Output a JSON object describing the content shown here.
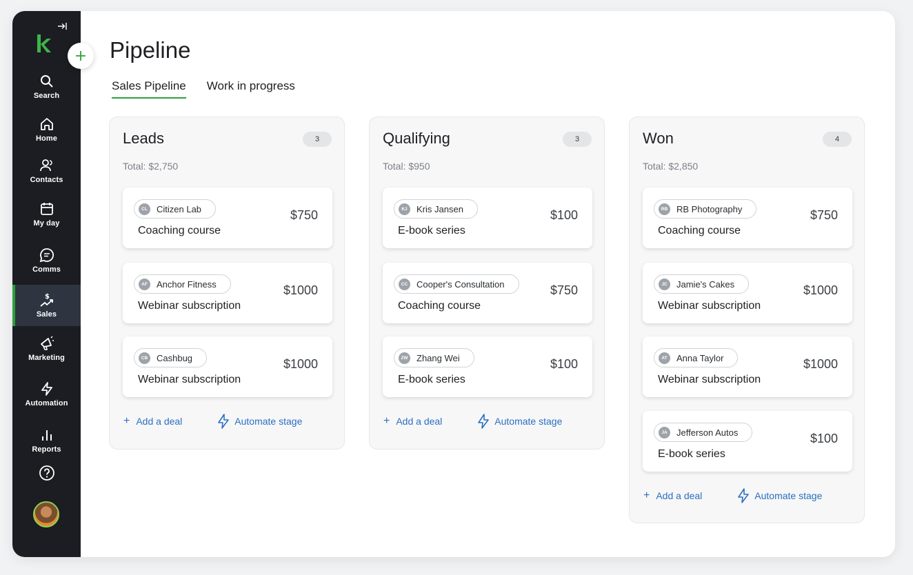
{
  "app": {
    "brand_color": "#2e9e3e",
    "link_color": "#2a6fc0"
  },
  "sidebar": {
    "items": [
      {
        "label": "Search",
        "icon": "search-icon"
      },
      {
        "label": "Home",
        "icon": "home-icon"
      },
      {
        "label": "Contacts",
        "icon": "contacts-icon"
      },
      {
        "label": "My day",
        "icon": "calendar-icon"
      },
      {
        "label": "Comms",
        "icon": "chat-icon"
      },
      {
        "label": "Sales",
        "icon": "sales-icon",
        "active": true
      },
      {
        "label": "Marketing",
        "icon": "megaphone-icon"
      },
      {
        "label": "Automation",
        "icon": "lightning-icon"
      },
      {
        "label": "Reports",
        "icon": "bar-chart-icon"
      }
    ]
  },
  "header": {
    "title": "Pipeline",
    "tabs": [
      {
        "label": "Sales Pipeline",
        "active": true
      },
      {
        "label": "Work in progress",
        "active": false
      }
    ]
  },
  "actions": {
    "add_deal": "Add a deal",
    "automate_stage": "Automate stage"
  },
  "columns": [
    {
      "title": "Leads",
      "count": "3",
      "total": "Total: $2,750",
      "deals": [
        {
          "initials": "CL",
          "contact": "Citizen Lab",
          "title": "Coaching course",
          "amount": "$750"
        },
        {
          "initials": "AF",
          "contact": "Anchor Fitness",
          "title": "Webinar subscription",
          "amount": "$1000"
        },
        {
          "initials": "CB",
          "contact": "Cashbug",
          "title": "Webinar subscription",
          "amount": "$1000"
        }
      ]
    },
    {
      "title": "Qualifying",
      "count": "3",
      "total": "Total: $950",
      "deals": [
        {
          "initials": "KJ",
          "contact": "Kris Jansen",
          "title": "E-book series",
          "amount": "$100"
        },
        {
          "initials": "CC",
          "contact": "Cooper's Consultation",
          "title": "Coaching course",
          "amount": "$750"
        },
        {
          "initials": "ZW",
          "contact": "Zhang Wei",
          "title": "E-book series",
          "amount": "$100"
        }
      ]
    },
    {
      "title": "Won",
      "count": "4",
      "total": "Total: $2,850",
      "deals": [
        {
          "initials": "RB",
          "contact": "RB Photography",
          "title": "Coaching course",
          "amount": "$750"
        },
        {
          "initials": "JC",
          "contact": "Jamie's Cakes",
          "title": "Webinar subscription",
          "amount": "$1000"
        },
        {
          "initials": "AT",
          "contact": "Anna Taylor",
          "title": "Webinar subscription",
          "amount": "$1000"
        },
        {
          "initials": "JA",
          "contact": "Jefferson Autos",
          "title": "E-book series",
          "amount": "$100"
        }
      ]
    }
  ]
}
